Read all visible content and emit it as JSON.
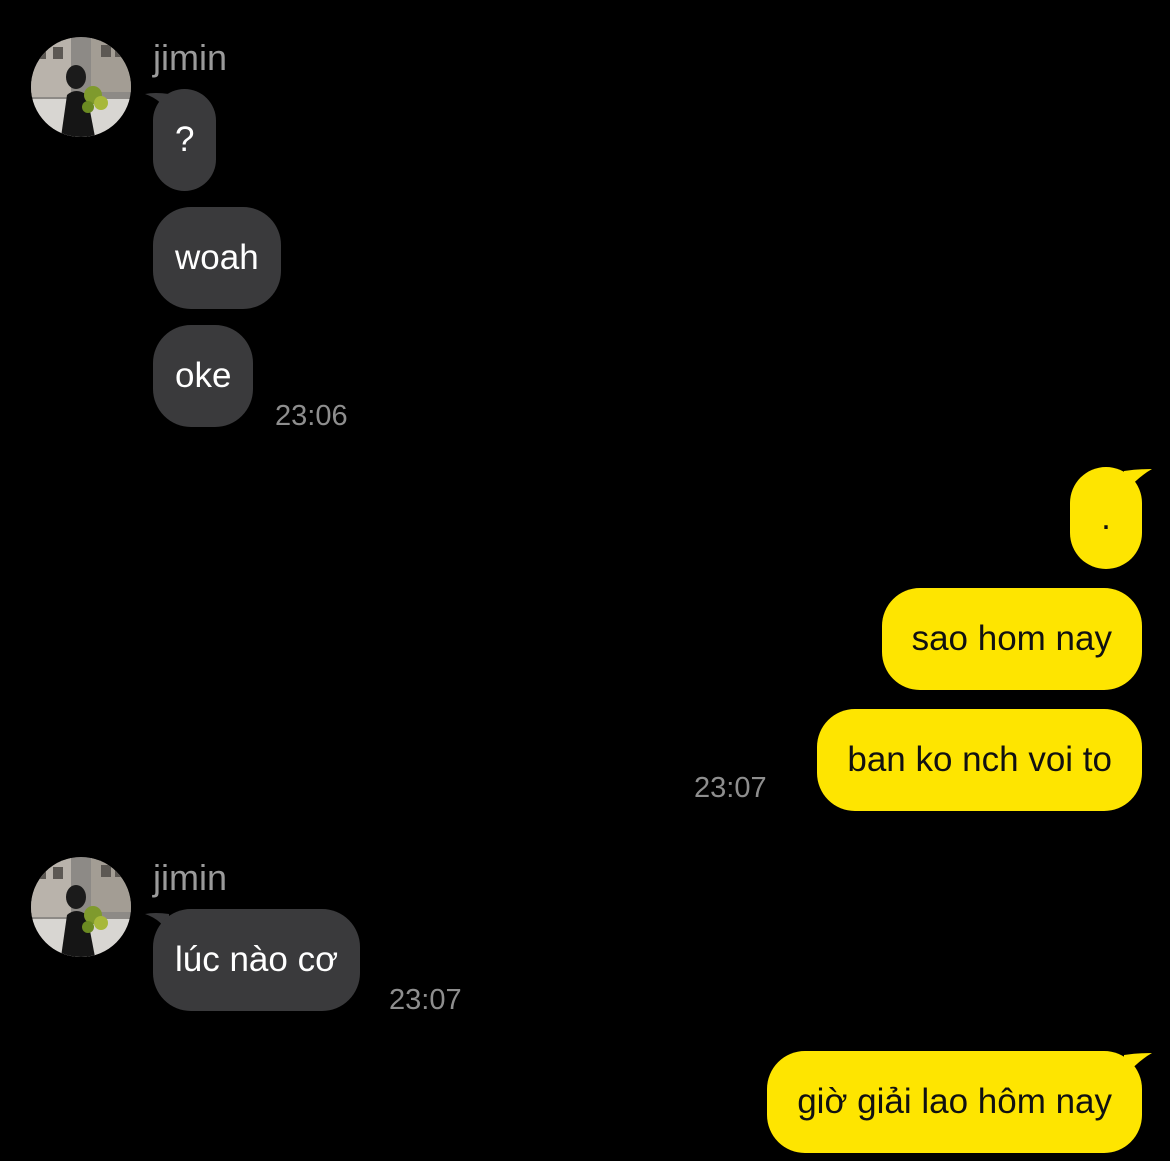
{
  "chat": {
    "groups": [
      {
        "sender": "jimin",
        "avatar_icon": "profile-photo-icon",
        "messages": [
          "?",
          "woah",
          "oke"
        ],
        "time": "23:06"
      },
      {
        "sender": "me",
        "messages": [
          ".",
          "sao hom nay",
          "ban ko nch voi to"
        ],
        "time": "23:07"
      },
      {
        "sender": "jimin",
        "avatar_icon": "profile-photo-icon",
        "messages": [
          "lúc nào cơ"
        ],
        "time": "23:07"
      },
      {
        "sender": "me",
        "messages": [
          "giờ giải lao hôm nay"
        ]
      }
    ]
  },
  "colors": {
    "background": "#000000",
    "incoming_bubble": "#3a3a3c",
    "outgoing_bubble": "#fee500",
    "incoming_text": "#ffffff",
    "outgoing_text": "#111111",
    "secondary_text": "#8e8e8e"
  }
}
